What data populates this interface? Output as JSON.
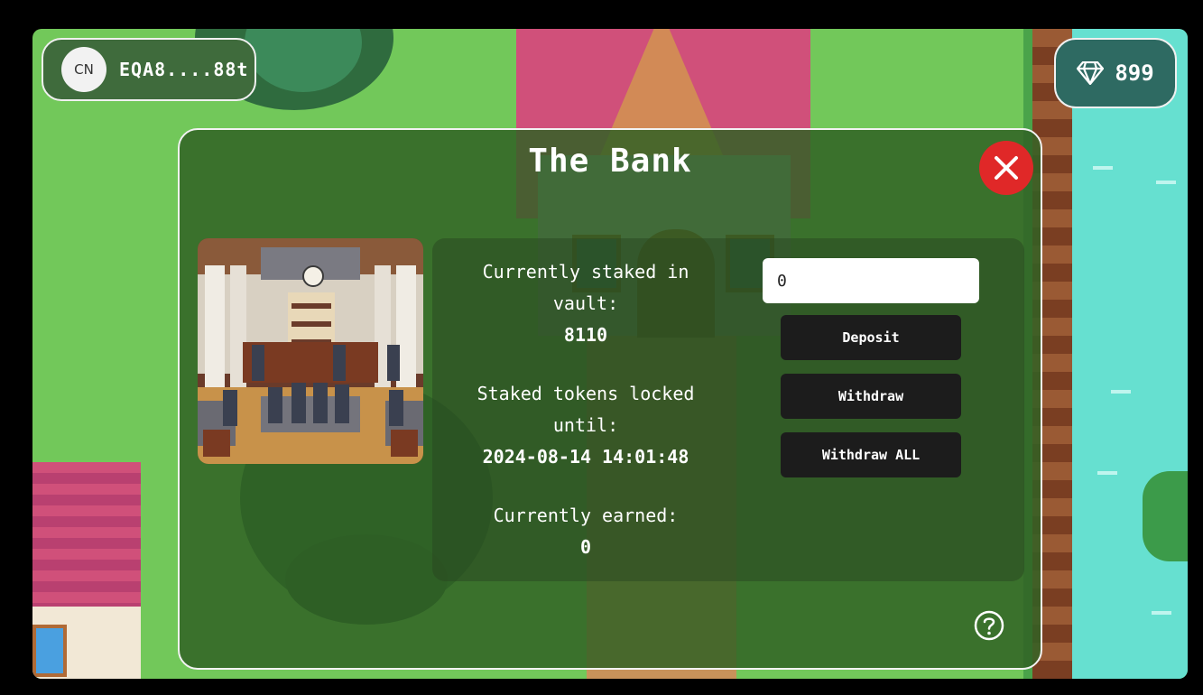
{
  "wallet": {
    "avatar_text": "CN",
    "address": "EQA8....88t"
  },
  "balance": {
    "icon": "diamond-icon",
    "value": "899"
  },
  "modal": {
    "title": "The Bank",
    "close_icon": "close-icon",
    "image_alt": "Bank interior",
    "staked": {
      "label": "Currently staked in vault:",
      "value": "8110"
    },
    "locked": {
      "label": "Staked tokens locked until:",
      "value": "2024-08-14 14:01:48"
    },
    "earned": {
      "label": "Currently earned:",
      "value": "0"
    },
    "amount_input": {
      "value": "0"
    },
    "buttons": {
      "deposit": "Deposit",
      "withdraw": "Withdraw",
      "withdraw_all": "Withdraw ALL"
    },
    "help_icon": "help-icon"
  },
  "colors": {
    "close": "#e02828",
    "button": "#1c1c1c",
    "modal_border": "#f2f2f2"
  }
}
